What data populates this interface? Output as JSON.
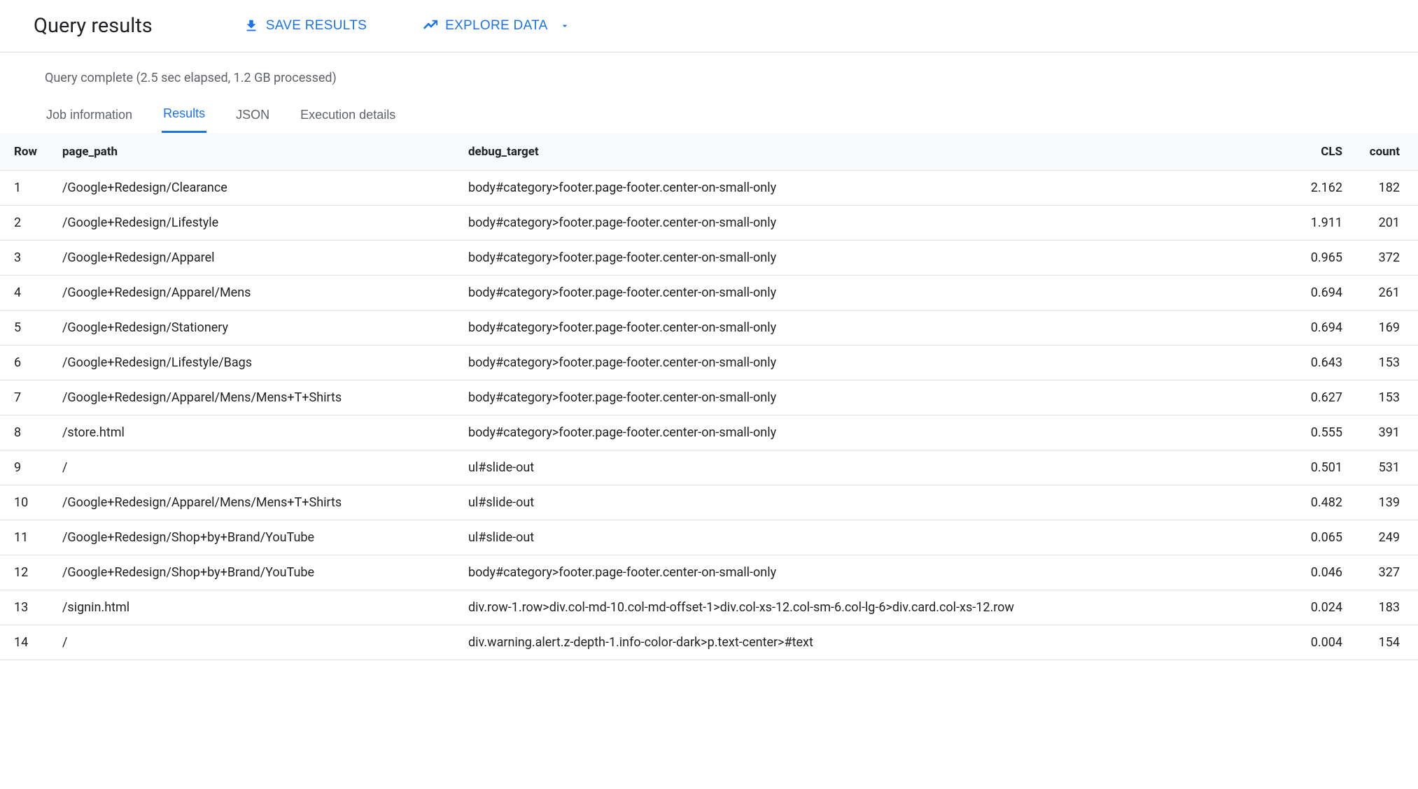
{
  "header": {
    "title": "Query results",
    "save_label": "SAVE RESULTS",
    "explore_label": "EXPLORE DATA"
  },
  "status": "Query complete (2.5 sec elapsed, 1.2 GB processed)",
  "tabs": {
    "job_info": "Job information",
    "results": "Results",
    "json": "JSON",
    "exec": "Execution details"
  },
  "columns": {
    "row": "Row",
    "page_path": "page_path",
    "debug_target": "debug_target",
    "cls": "CLS",
    "count": "count"
  },
  "rows": [
    {
      "n": "1",
      "page_path": "/Google+Redesign/Clearance",
      "debug_target": "body#category>footer.page-footer.center-on-small-only",
      "cls": "2.162",
      "count": "182"
    },
    {
      "n": "2",
      "page_path": "/Google+Redesign/Lifestyle",
      "debug_target": "body#category>footer.page-footer.center-on-small-only",
      "cls": "1.911",
      "count": "201"
    },
    {
      "n": "3",
      "page_path": "/Google+Redesign/Apparel",
      "debug_target": "body#category>footer.page-footer.center-on-small-only",
      "cls": "0.965",
      "count": "372"
    },
    {
      "n": "4",
      "page_path": "/Google+Redesign/Apparel/Mens",
      "debug_target": "body#category>footer.page-footer.center-on-small-only",
      "cls": "0.694",
      "count": "261"
    },
    {
      "n": "5",
      "page_path": "/Google+Redesign/Stationery",
      "debug_target": "body#category>footer.page-footer.center-on-small-only",
      "cls": "0.694",
      "count": "169"
    },
    {
      "n": "6",
      "page_path": "/Google+Redesign/Lifestyle/Bags",
      "debug_target": "body#category>footer.page-footer.center-on-small-only",
      "cls": "0.643",
      "count": "153"
    },
    {
      "n": "7",
      "page_path": "/Google+Redesign/Apparel/Mens/Mens+T+Shirts",
      "debug_target": "body#category>footer.page-footer.center-on-small-only",
      "cls": "0.627",
      "count": "153"
    },
    {
      "n": "8",
      "page_path": "/store.html",
      "debug_target": "body#category>footer.page-footer.center-on-small-only",
      "cls": "0.555",
      "count": "391"
    },
    {
      "n": "9",
      "page_path": "/",
      "debug_target": "ul#slide-out",
      "cls": "0.501",
      "count": "531"
    },
    {
      "n": "10",
      "page_path": "/Google+Redesign/Apparel/Mens/Mens+T+Shirts",
      "debug_target": "ul#slide-out",
      "cls": "0.482",
      "count": "139"
    },
    {
      "n": "11",
      "page_path": "/Google+Redesign/Shop+by+Brand/YouTube",
      "debug_target": "ul#slide-out",
      "cls": "0.065",
      "count": "249"
    },
    {
      "n": "12",
      "page_path": "/Google+Redesign/Shop+by+Brand/YouTube",
      "debug_target": "body#category>footer.page-footer.center-on-small-only",
      "cls": "0.046",
      "count": "327"
    },
    {
      "n": "13",
      "page_path": "/signin.html",
      "debug_target": "div.row-1.row>div.col-md-10.col-md-offset-1>div.col-xs-12.col-sm-6.col-lg-6>div.card.col-xs-12.row",
      "cls": "0.024",
      "count": "183"
    },
    {
      "n": "14",
      "page_path": "/",
      "debug_target": "div.warning.alert.z-depth-1.info-color-dark>p.text-center>#text",
      "cls": "0.004",
      "count": "154"
    }
  ]
}
